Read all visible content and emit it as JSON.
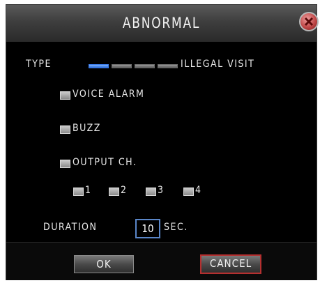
{
  "dialog": {
    "title": "ABNORMAL"
  },
  "type": {
    "label": "TYPE",
    "value": "ILLEGAL VISIT",
    "segments": 4,
    "selected_index": 0
  },
  "options": {
    "voice_alarm": "VOICE ALARM",
    "buzz": "BUZZ",
    "output_ch": "OUTPUT CH."
  },
  "channels": [
    "1",
    "2",
    "3",
    "4"
  ],
  "duration": {
    "label": "DURATION",
    "value": "10",
    "unit": "SEC."
  },
  "buttons": {
    "ok": "OK",
    "cancel": "CANCEL"
  },
  "colors": {
    "background": "#000000",
    "accent_blue": "#3a7ae8",
    "cancel_border": "#b43030"
  }
}
